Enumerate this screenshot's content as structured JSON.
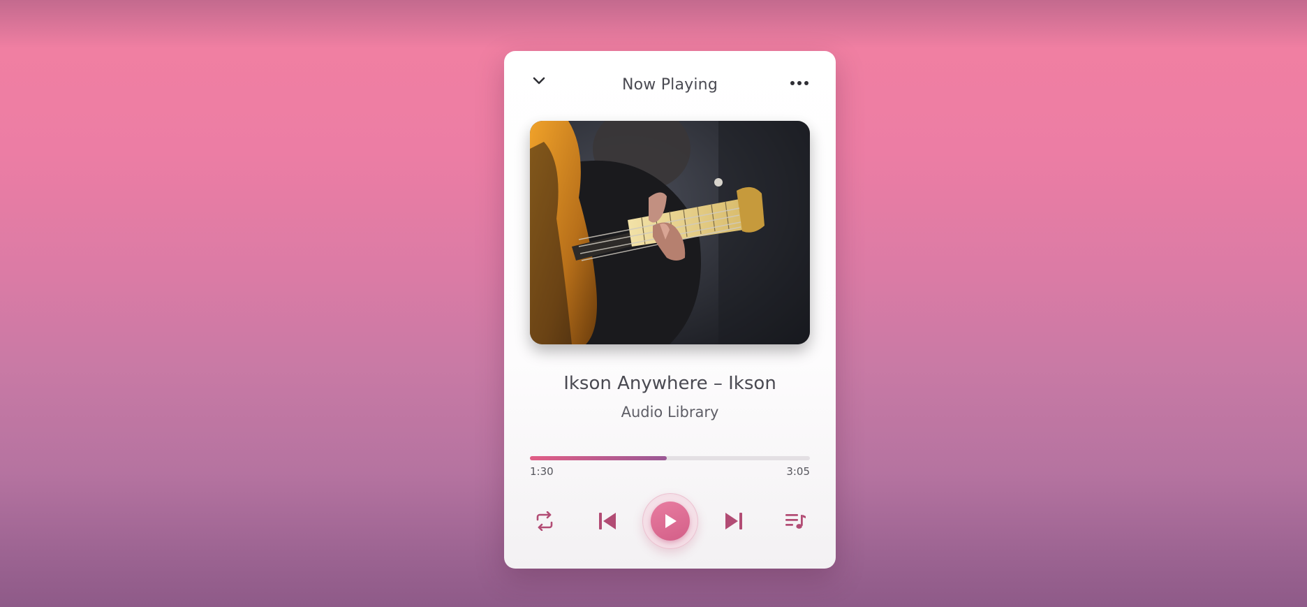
{
  "player": {
    "title": "Now Playing",
    "song_title": "Ikson Anywhere – Ikson",
    "artist": "Audio Library",
    "elapsed": "1:30",
    "total": "3:05",
    "progress_fraction": 0.49
  },
  "icons": {
    "collapse": "chevron-down-icon",
    "menu": "more-horizontal-icon",
    "repeat": "repeat-icon",
    "previous": "skip-previous-icon",
    "play": "play-icon",
    "next": "skip-next-icon",
    "playlist": "playlist-icon"
  },
  "colors": {
    "accent": "#d35f88",
    "accent_dark": "#b24c74",
    "text": "#4a4a52"
  }
}
